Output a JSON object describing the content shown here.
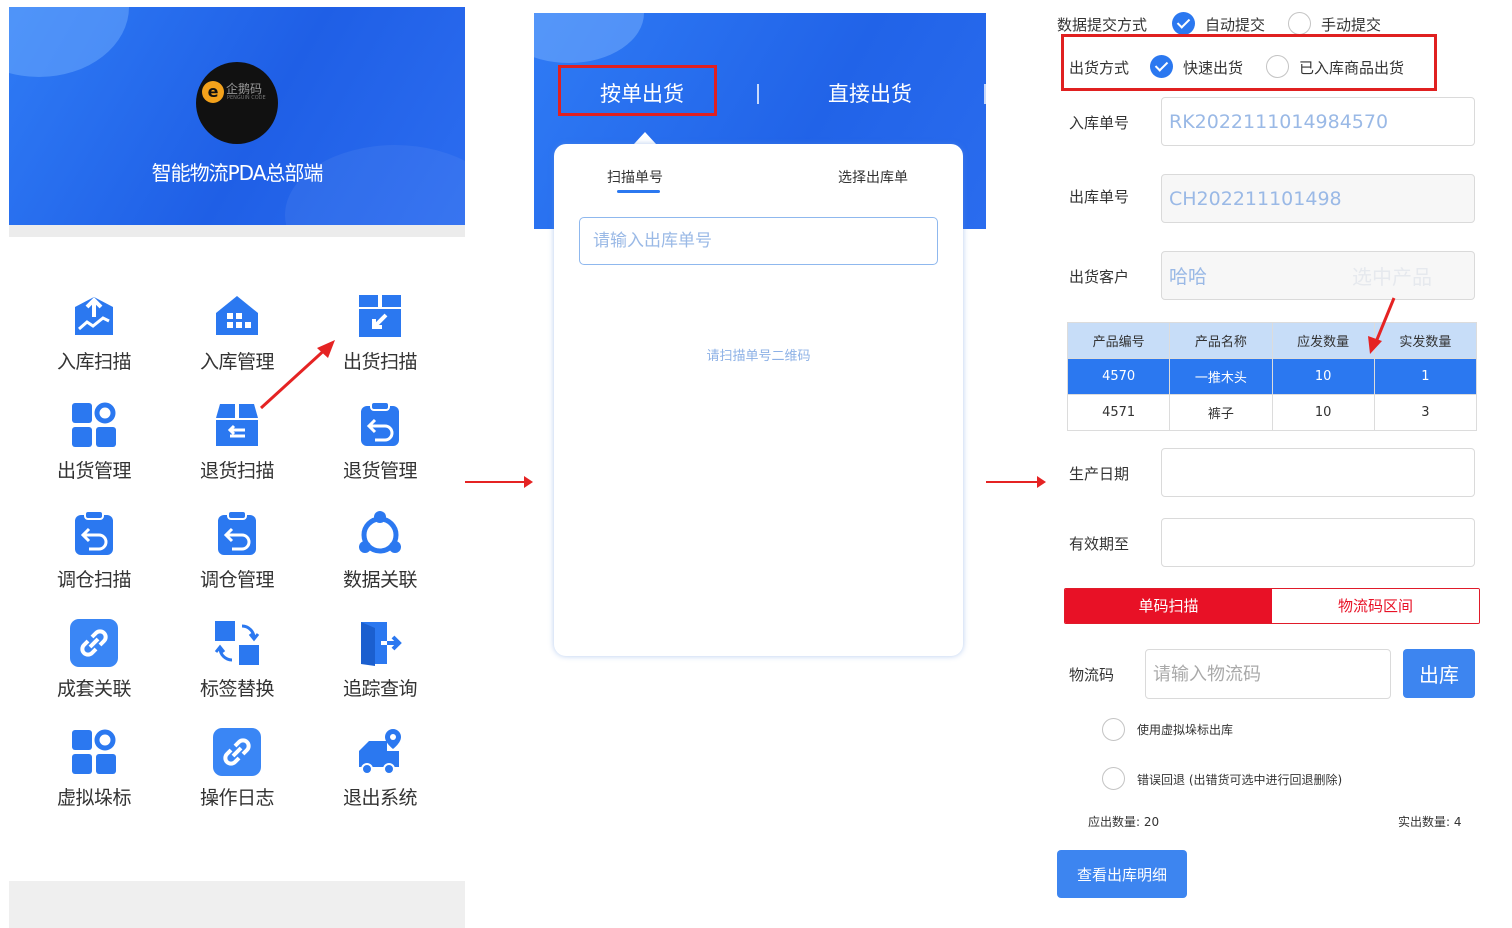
{
  "home": {
    "logo_text": "企鹅码",
    "logo_sub": "PENGUIN CODE",
    "app_title": "智能物流PDA总部端",
    "menu": [
      {
        "label": "入库扫描",
        "icon": "inbound-scan-icon"
      },
      {
        "label": "入库管理",
        "icon": "warehouse-icon"
      },
      {
        "label": "出货扫描",
        "icon": "outbound-scan-icon"
      },
      {
        "label": "出货管理",
        "icon": "grid-gear-icon"
      },
      {
        "label": "退货扫描",
        "icon": "return-box-icon"
      },
      {
        "label": "退货管理",
        "icon": "return-clipboard-icon"
      },
      {
        "label": "调仓扫描",
        "icon": "transfer-clipboard-icon"
      },
      {
        "label": "调仓管理",
        "icon": "transfer-clipboard-icon"
      },
      {
        "label": "数据关联",
        "icon": "data-link-icon"
      },
      {
        "label": "成套关联",
        "icon": "link-icon"
      },
      {
        "label": "标签替换",
        "icon": "swap-icon"
      },
      {
        "label": "追踪查询",
        "icon": "exit-door-icon"
      },
      {
        "label": "虚拟垛标",
        "icon": "grid-gear-icon"
      },
      {
        "label": "操作日志",
        "icon": "link-icon"
      },
      {
        "label": "退出系统",
        "icon": "truck-location-icon"
      }
    ]
  },
  "outbound": {
    "tab_active": "按单出货",
    "tab_other": "直接出货",
    "sub_tab_scan": "扫描单号",
    "sub_tab_select": "选择出库单",
    "input_placeholder": "请输入出库单号",
    "hint": "请扫描单号二维码"
  },
  "form": {
    "submit_mode_label": "数据提交方式",
    "submit_auto": "自动提交",
    "submit_manual": "手动提交",
    "ship_mode_label": "出货方式",
    "ship_fast": "快速出货",
    "ship_stocked": "已入库商品出货",
    "inbound_no_label": "入库单号",
    "inbound_no": "RK2022111014984570",
    "outbound_no_label": "出库单号",
    "outbound_no": "CH202211101498",
    "customer_label": "出货客户",
    "customer": "哈哈",
    "watermark": "选中产品",
    "table": {
      "headers": [
        "产品编号",
        "产品名称",
        "应发数量",
        "实发数量"
      ],
      "rows": [
        [
          "4570",
          "一推木头",
          "10",
          "1"
        ],
        [
          "4571",
          "裤子",
          "10",
          "3"
        ]
      ]
    },
    "prod_date_label": "生产日期",
    "expiry_label": "有效期至",
    "seg_single": "单码扫描",
    "seg_range": "物流码区间",
    "code_label": "物流码",
    "code_placeholder": "请输入物流码",
    "out_button": "出库",
    "virtual_stack": "使用虚拟垛标出库",
    "error_rollback": "错误回退 (出错货可选中进行回退删除)",
    "should_qty": "应出数量: 20",
    "actual_qty": "实出数量: 4",
    "detail_button": "查看出库明细"
  },
  "colors": {
    "brand_blue": "#2b78f0",
    "highlight_red": "#e02020",
    "segment_red": "#e81126"
  }
}
